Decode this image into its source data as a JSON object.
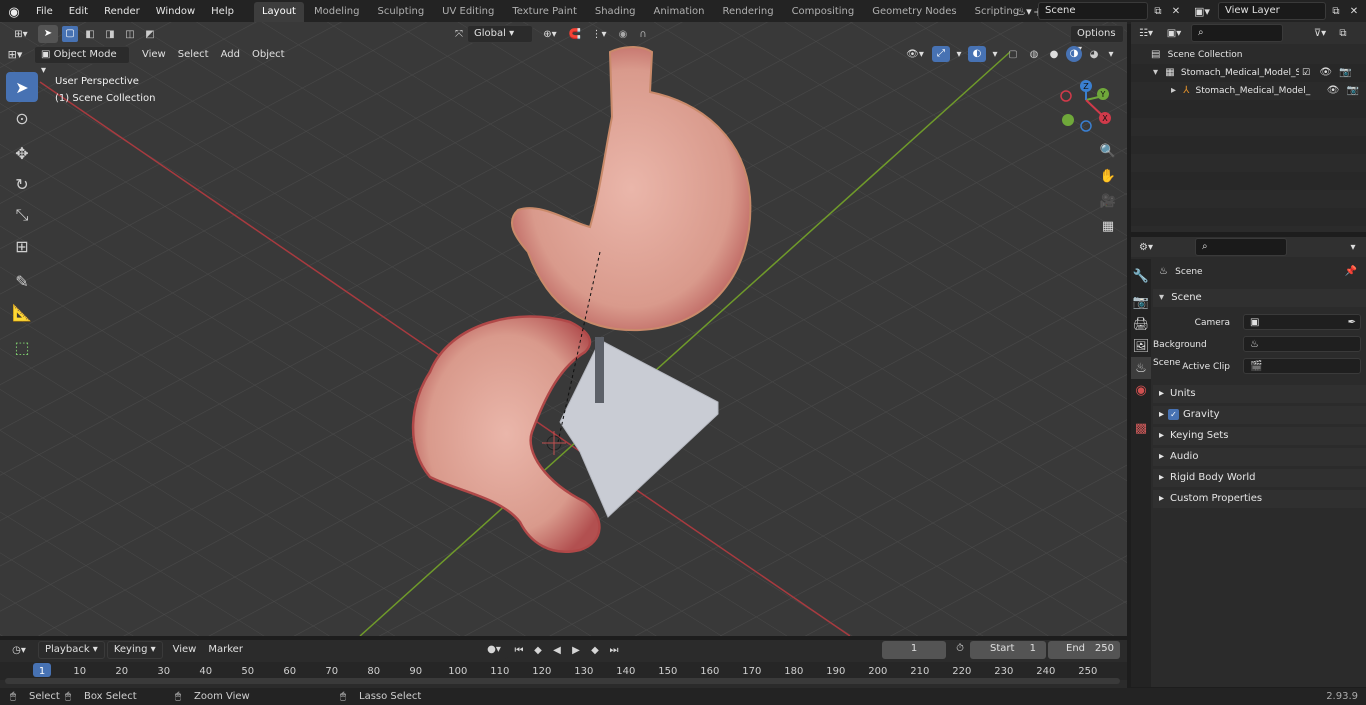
{
  "menus": [
    "File",
    "Edit",
    "Render",
    "Window",
    "Help"
  ],
  "workspaces": [
    "Layout",
    "Modeling",
    "Sculpting",
    "UV Editing",
    "Texture Paint",
    "Shading",
    "Animation",
    "Rendering",
    "Compositing",
    "Geometry Nodes",
    "Scripting"
  ],
  "active_workspace": "Layout",
  "scene_name": "Scene",
  "view_layer": "View Layer",
  "viewport": {
    "mode": "Object Mode",
    "menus": [
      "View",
      "Select",
      "Add",
      "Object"
    ],
    "transform_orientation": "Global",
    "options_label": "Options",
    "perspective_label": "User Perspective",
    "collection_label": "(1) Scene Collection"
  },
  "gizmo": {
    "x": "X",
    "y": "Y",
    "z": "Z"
  },
  "outliner": {
    "root": "Scene Collection",
    "items": [
      "Stomach_Medical_Model_Slice",
      "Stomach_Medical_Model_"
    ]
  },
  "properties": {
    "breadcrumb": "Scene",
    "panel_title": "Scene",
    "camera_label": "Camera",
    "background_scene_label": "Background Scene",
    "active_clip_label": "Active Clip",
    "sections": [
      "Units",
      "Gravity",
      "Keying Sets",
      "Audio",
      "Rigid Body World",
      "Custom Properties"
    ],
    "gravity_checked": true
  },
  "timeline": {
    "menus": [
      "Playback",
      "Keying",
      "View",
      "Marker"
    ],
    "current_frame": "1",
    "start_label": "Start",
    "start_value": "1",
    "end_label": "End",
    "end_value": "250",
    "ticks": [
      "1",
      "10",
      "20",
      "30",
      "40",
      "50",
      "60",
      "70",
      "80",
      "90",
      "100",
      "110",
      "120",
      "130",
      "140",
      "150",
      "160",
      "170",
      "180",
      "190",
      "200",
      "210",
      "220",
      "230",
      "240",
      "250"
    ]
  },
  "statusbar": {
    "select": "Select",
    "box_select": "Box Select",
    "zoom_view": "Zoom View",
    "lasso_select": "Lasso Select",
    "version": "2.93.9"
  }
}
